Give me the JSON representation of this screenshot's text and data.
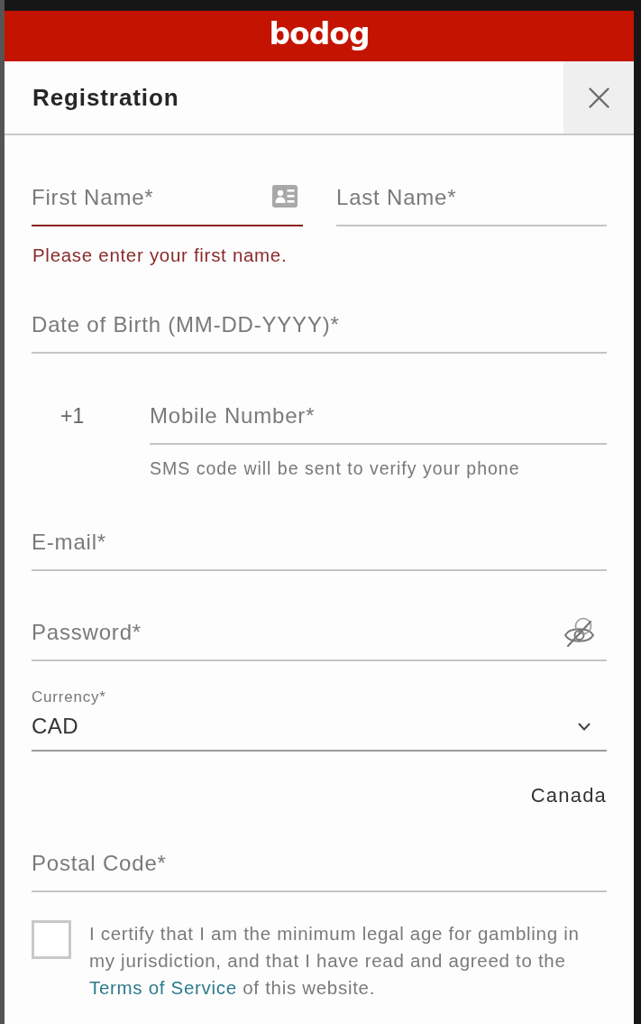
{
  "header": {
    "logo": "bodog"
  },
  "dialog": {
    "title": "Registration"
  },
  "name_fields": [
    {
      "placeholder": "First Name*",
      "invalid": true,
      "autofill_icon": true,
      "error": "Please enter your first name."
    },
    {
      "placeholder": "Last Name*",
      "invalid": false,
      "autofill_icon": false
    }
  ],
  "date_of_birth": {
    "placeholder": "Date of Birth (MM-DD-YYYY)*"
  },
  "phone": {
    "prefix": "+1",
    "placeholder": "Mobile Number*",
    "hint": "SMS code will be sent to verify your phone"
  },
  "email": {
    "placeholder": "E-mail*"
  },
  "password": {
    "placeholder": "Password*",
    "visible": false
  },
  "currency": {
    "label": "Currency*",
    "value": "CAD"
  },
  "country": "Canada",
  "postal_code": {
    "placeholder": "Postal Code*"
  },
  "age_confirmation": {
    "checked": false,
    "text_before": "I certify that I am the minimum legal age for gambling in my jurisdiction, and that I have read and agreed to the ",
    "link": "Terms of Service",
    "text_after": " of this website."
  }
}
